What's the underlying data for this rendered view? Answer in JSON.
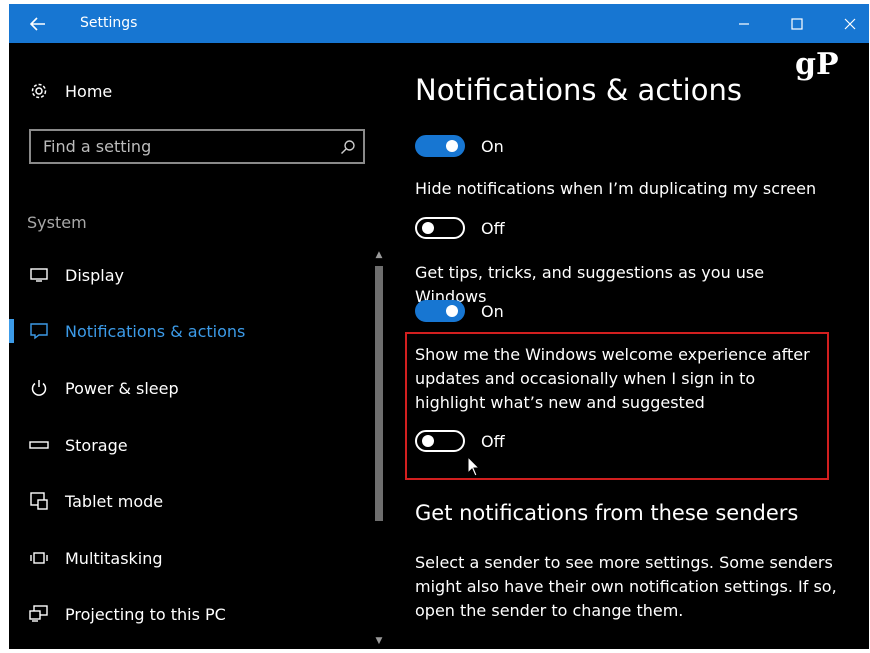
{
  "titlebar": {
    "app_title": "Settings",
    "back_icon": "arrow-left-icon",
    "controls": [
      "minimize-icon",
      "maximize-icon",
      "close-icon"
    ]
  },
  "sidebar": {
    "home_label": "Home",
    "search": {
      "placeholder": "Find a setting",
      "value": ""
    },
    "section_label": "System",
    "items": [
      {
        "label": "Display",
        "icon": "monitor-icon",
        "active": false
      },
      {
        "label": "Notifications & actions",
        "icon": "notification-icon",
        "active": true
      },
      {
        "label": "Power & sleep",
        "icon": "power-icon",
        "active": false
      },
      {
        "label": "Storage",
        "icon": "storage-icon",
        "active": false
      },
      {
        "label": "Tablet mode",
        "icon": "tablet-mode-icon",
        "active": false
      },
      {
        "label": "Multitasking",
        "icon": "multitasking-icon",
        "active": false
      },
      {
        "label": "Projecting to this PC",
        "icon": "projecting-icon",
        "active": false
      }
    ]
  },
  "main": {
    "page_title": "Notifications & actions",
    "logo": "gP",
    "settings": [
      {
        "label": "",
        "state": "On",
        "on": true
      },
      {
        "label": "Hide notifications when I’m duplicating my screen",
        "state": "Off",
        "on": false
      },
      {
        "label": "Get tips, tricks, and suggestions as you use Windows",
        "state": "On",
        "on": true
      },
      {
        "label": "Show me the Windows welcome experience after updates and occasionally when I sign in to highlight what’s new and suggested",
        "state": "Off",
        "on": false,
        "highlighted": true
      }
    ],
    "senders_heading": "Get notifications from these senders",
    "senders_description": "Select a sender to see more settings. Some senders might also have their own notification settings. If so, open the sender to change them."
  },
  "colors": {
    "accent": "#1776d2",
    "active_nav": "#3c9be8",
    "highlight_border": "#d21f1f",
    "background": "#000000"
  }
}
